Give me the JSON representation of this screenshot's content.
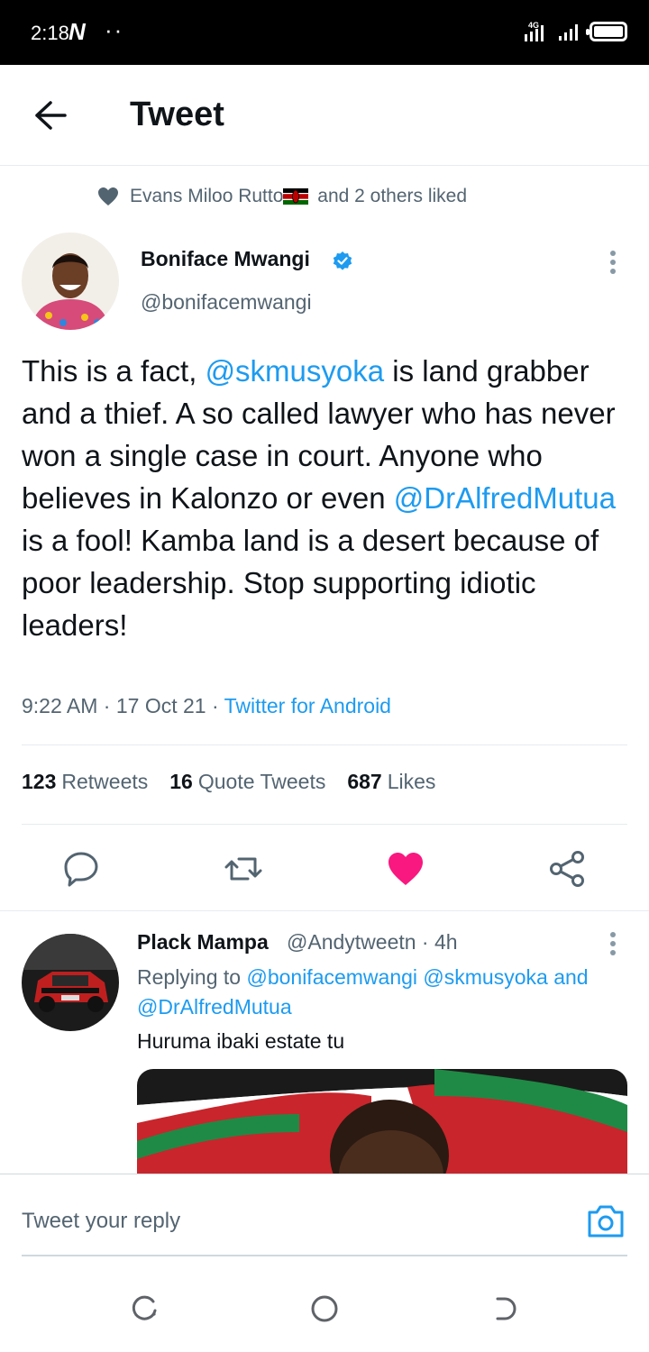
{
  "status_bar": {
    "time": "2:18",
    "network": "4G"
  },
  "header": {
    "title": "Tweet"
  },
  "social_context": {
    "liker": "Evans Miloo Rutto",
    "suffix": "and 2 others liked"
  },
  "tweet": {
    "author_name": "Boniface Mwangi",
    "author_handle": "@bonifacemwangi",
    "verified": true,
    "text_parts": {
      "t1": "This is a fact, ",
      "m1": "@skmusyoka",
      "t2": " is land grabber and a thief. A so called lawyer who has never won a single case in court. Anyone who believes in Kalonzo or even ",
      "m2": "@DrAlfredMutua",
      "t3": " is a fool! Kamba land is a desert because of poor leadership. Stop supporting idiotic leaders!"
    },
    "time": "9:22 AM",
    "date": "17 Oct 21",
    "source": "Twitter for Android",
    "stats": {
      "retweets_count": "123",
      "retweets_label": "Retweets",
      "quotes_count": "16",
      "quotes_label": "Quote Tweets",
      "likes_count": "687",
      "likes_label": "Likes"
    }
  },
  "reply": {
    "author_name": "Plack Mampa",
    "author_handle": "@Andytweetn · 4h",
    "replying_prefix": "Replying to ",
    "replying_to_1": "@bonifacemwangi",
    "replying_to_2": "@skmusyoka",
    "replying_and": " and ",
    "replying_to_3": "@DrAlfredMutua",
    "text": "Huruma ibaki estate tu"
  },
  "compose": {
    "placeholder": "Tweet your reply"
  },
  "colors": {
    "accent": "#1d9bf0",
    "like": "#f91880",
    "muted": "#536471"
  }
}
